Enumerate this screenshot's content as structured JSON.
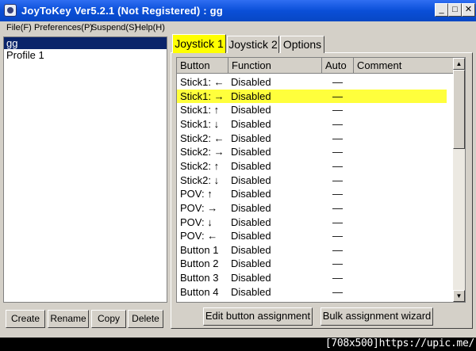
{
  "window": {
    "title": "JoyToKey Ver5.2.1 (Not Registered) : gg",
    "minimize_glyph": "_",
    "maximize_glyph": "□",
    "close_glyph": "✕"
  },
  "menu": [
    "File(F)",
    "Preferences(P)",
    "Suspend(S)",
    "Help(H)"
  ],
  "profiles": {
    "items": [
      "gg",
      "Profile 1"
    ],
    "selected_index": 0
  },
  "profile_buttons": {
    "create": "Create",
    "rename": "Rename",
    "copy": "Copy",
    "delete": "Delete"
  },
  "tabs": [
    "Joystick 1",
    "Joystick 2",
    "Options"
  ],
  "active_tab": 0,
  "table": {
    "headers": [
      "Button",
      "Function",
      "Auto",
      "Comment"
    ],
    "rows": [
      {
        "button": "Stick1: ←",
        "function": "Disabled",
        "auto": "—",
        "comment": ""
      },
      {
        "button": "Stick1: →",
        "function": "Disabled",
        "auto": "—",
        "comment": ""
      },
      {
        "button": "Stick1: ↑",
        "function": "Disabled",
        "auto": "—",
        "comment": ""
      },
      {
        "button": "Stick1: ↓",
        "function": "Disabled",
        "auto": "—",
        "comment": ""
      },
      {
        "button": "Stick2: ←",
        "function": "Disabled",
        "auto": "—",
        "comment": ""
      },
      {
        "button": "Stick2: →",
        "function": "Disabled",
        "auto": "—",
        "comment": ""
      },
      {
        "button": "Stick2: ↑",
        "function": "Disabled",
        "auto": "—",
        "comment": ""
      },
      {
        "button": "Stick2: ↓",
        "function": "Disabled",
        "auto": "—",
        "comment": ""
      },
      {
        "button": "POV: ↑",
        "function": "Disabled",
        "auto": "—",
        "comment": ""
      },
      {
        "button": "POV: →",
        "function": "Disabled",
        "auto": "—",
        "comment": ""
      },
      {
        "button": "POV: ↓",
        "function": "Disabled",
        "auto": "—",
        "comment": ""
      },
      {
        "button": "POV: ←",
        "function": "Disabled",
        "auto": "—",
        "comment": ""
      },
      {
        "button": "Button 1",
        "function": "Disabled",
        "auto": "—",
        "comment": ""
      },
      {
        "button": "Button 2",
        "function": "Disabled",
        "auto": "—",
        "comment": ""
      },
      {
        "button": "Button 3",
        "function": "Disabled",
        "auto": "—",
        "comment": ""
      },
      {
        "button": "Button 4",
        "function": "Disabled",
        "auto": "—",
        "comment": ""
      }
    ],
    "highlighted_index": 1,
    "scroll_up_glyph": "▲",
    "scroll_down_glyph": "▼"
  },
  "action_buttons": {
    "edit": "Edit button assignment",
    "wizard": "Bulk assignment wizard"
  },
  "watermark": "[708x500]https://upic.me/",
  "colors": {
    "highlight": "#ffff3c",
    "active_tab": "#ffff00",
    "selection": "#0a246a",
    "titlebar": "#0a4fd8"
  }
}
